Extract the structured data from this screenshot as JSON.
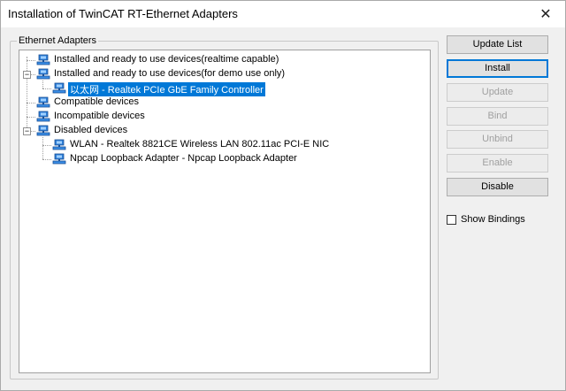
{
  "window": {
    "title": "Installation of TwinCAT RT-Ethernet Adapters",
    "close_glyph": "✕"
  },
  "group": {
    "label": "Ethernet Adapters"
  },
  "tree": {
    "nodes": [
      {
        "label": "Installed and ready to use devices(realtime capable)",
        "expander": "",
        "selected": false
      },
      {
        "label": "Installed and ready to use devices(for demo use only)",
        "expander": "−",
        "selected": false
      },
      {
        "label": "以太网 - Realtek PCIe GbE Family Controller",
        "expander": "",
        "selected": true
      },
      {
        "label": "Compatible devices",
        "expander": "",
        "selected": false
      },
      {
        "label": "Incompatible devices",
        "expander": "",
        "selected": false
      },
      {
        "label": "Disabled devices",
        "expander": "−",
        "selected": false
      },
      {
        "label": "WLAN - Realtek 8821CE Wireless LAN 802.11ac PCI-E NIC",
        "expander": "",
        "selected": false
      },
      {
        "label": "Npcap Loopback Adapter - Npcap Loopback Adapter",
        "expander": "",
        "selected": false
      }
    ]
  },
  "buttons": {
    "update_list": "Update List",
    "install": "Install",
    "update": "Update",
    "bind": "Bind",
    "unbind": "Unbind",
    "enable": "Enable",
    "disable": "Disable"
  },
  "options": {
    "show_bindings_label": "Show Bindings",
    "show_bindings_checked": false
  },
  "colors": {
    "selection": "#0078d7",
    "icon_blue": "#2f7fd8"
  }
}
